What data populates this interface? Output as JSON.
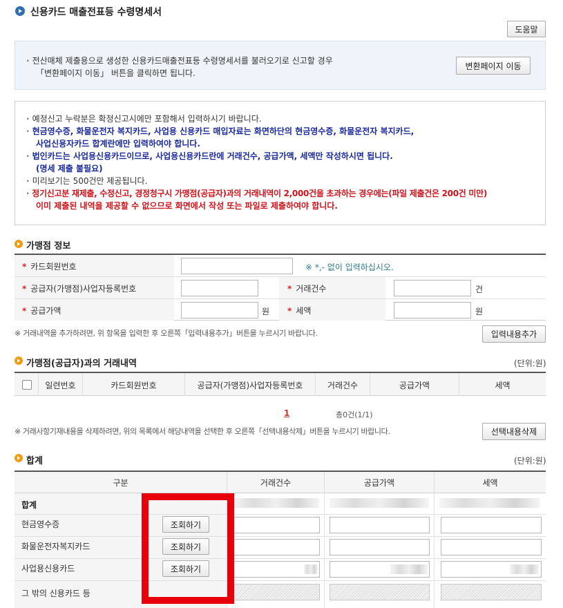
{
  "page": {
    "title": "신용카드 매출전표등 수령명세서",
    "help_button": "도움말"
  },
  "info_box": {
    "line1": "전산매체 제출용으로 생성한 신용카드매출전표등 수령명세서를 불러오기로 신고할 경우",
    "line2": "「변환페이지 이동」 버튼을 클릭하면 됩니다.",
    "button": "변환페이지 이동"
  },
  "notice": {
    "items": [
      {
        "text": "예정신고 누락분은 확정신고시에만 포함해서 입력하시기 바랍니다.",
        "style": "normal"
      },
      {
        "text": "현금영수증, 화물운전자 복지카드, 사업용 신용카드 매입자료는 화면하단의 현금영수증, 화물운전자 복지카드,",
        "style": "blue"
      },
      {
        "text": "사업신용자카드 합계란에만 입력하여야 합니다.",
        "style": "blue-indent"
      },
      {
        "text": "법인카드는 사업용신용카드이므로, 사업용신용카드란에 거래건수, 공급가액, 세액만 작성하시면 됩니다.",
        "style": "blue"
      },
      {
        "text": "(명세 제출 불필요)",
        "style": "blue-indent"
      },
      {
        "text": "미리보기는 500건만 제공됩니다.",
        "style": "normal"
      },
      {
        "text": "정기신고분 재제출, 수정신고, 경정청구시 가맹점(공급자)과의 거래내역이 2,000건을 초과하는 경우에는(파일 제출건은 200건 미만)",
        "style": "red"
      },
      {
        "text": "이미 제출된 내역을 제공할 수 없으므로 화면에서 작성 또는 파일로 제출하여야 합니다.",
        "style": "red-indent"
      }
    ]
  },
  "merchant": {
    "section_title": "가맹점 정보",
    "card_no_label": "카드회원번호",
    "card_no_hint": "※ *,- 없이 입력하십시오.",
    "biz_no_label": "공급자(가맹점)사업자등록번호",
    "count_label": "거래건수",
    "count_unit": "건",
    "amount_label": "공급가액",
    "amount_unit": "원",
    "tax_label": "세액",
    "tax_unit": "원",
    "add_hint": "※ 거래내역을 추가하려면, 위 항목을 입력한 후 오른쪽「입력내용추가」버튼을 누르시기 바랍니다.",
    "add_button": "입력내용추가"
  },
  "transactions": {
    "section_title": "가맹점(공급자)과의 거래내역",
    "unit": "(단위:원)",
    "columns": [
      "일련번호",
      "카드회원번호",
      "공급자(가맹점)사업자등록번호",
      "거래건수",
      "공급가액",
      "세액"
    ],
    "page_current": "1",
    "page_info": "총0건(1/1)",
    "delete_hint": "※ 거래사항기재내용을 삭제하려면, 위의 목록에서 해당내역을 선택한 후 오른쪽「선택내용삭제」버튼을 누르시기 바랍니다.",
    "delete_button": "선택내용삭제"
  },
  "summary": {
    "section_title": "합계",
    "unit": "(단위:원)",
    "columns": [
      "구분",
      "거래건수",
      "공급가액",
      "세액"
    ],
    "rows": [
      {
        "label": "합계"
      },
      {
        "label": "현금영수증",
        "button": "조회하기"
      },
      {
        "label": "화물운전자복지카드",
        "button": "조회하기"
      },
      {
        "label": "사업용신용카드",
        "button": "조회하기"
      },
      {
        "label": "그 밖의 신용카드 등"
      }
    ],
    "highlight_color": "#e8000b"
  }
}
